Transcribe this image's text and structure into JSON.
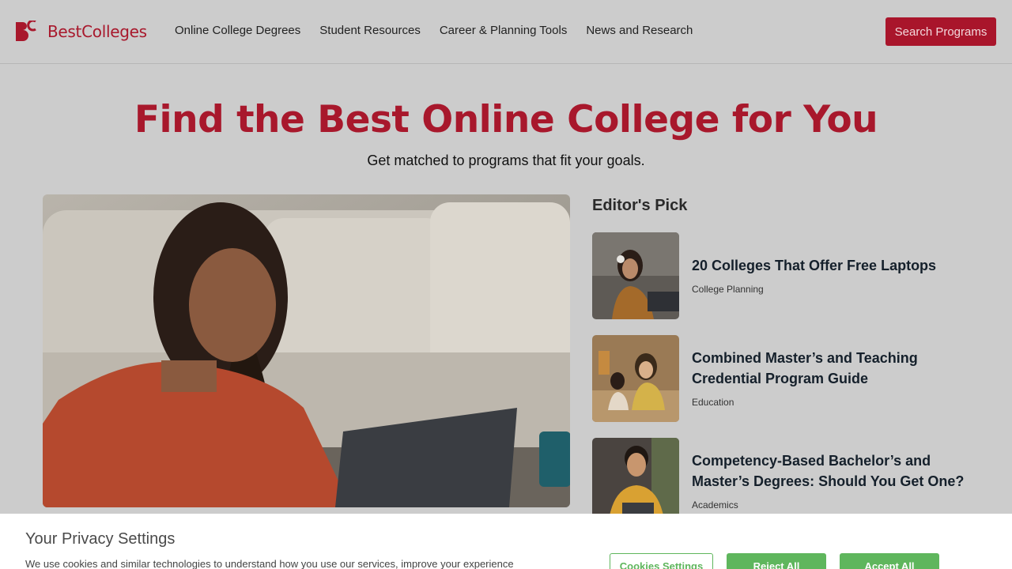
{
  "header": {
    "logo_text": "BestColleges",
    "nav": [
      {
        "label": "Online College Degrees"
      },
      {
        "label": "Student Resources"
      },
      {
        "label": "Career & Planning Tools"
      },
      {
        "label": "News and Research"
      }
    ],
    "search_button": "Search Programs"
  },
  "hero": {
    "title": "Find the Best Online College for You",
    "subtitle": "Get matched to programs that fit your goals."
  },
  "editors_pick": {
    "heading": "Editor's Pick",
    "items": [
      {
        "title": "20 Colleges That Offer Free Laptops",
        "category": "College Planning"
      },
      {
        "title": "Combined Master’s and Teaching Credential Program Guide",
        "category": "Education"
      },
      {
        "title": "Competency-Based Bachelor’s and Master’s Degrees: Should You Get One?",
        "category": "Academics"
      }
    ]
  },
  "cookie_banner": {
    "title": "Your Privacy Settings",
    "text": "We use cookies and similar technologies to understand how you use our services, improve your experience",
    "settings_button": "Cookies Settings",
    "reject_button": "Reject All",
    "accept_button": "Accept All"
  },
  "colors": {
    "brand": "#a8182c",
    "cookie_green": "#5fb65d"
  }
}
